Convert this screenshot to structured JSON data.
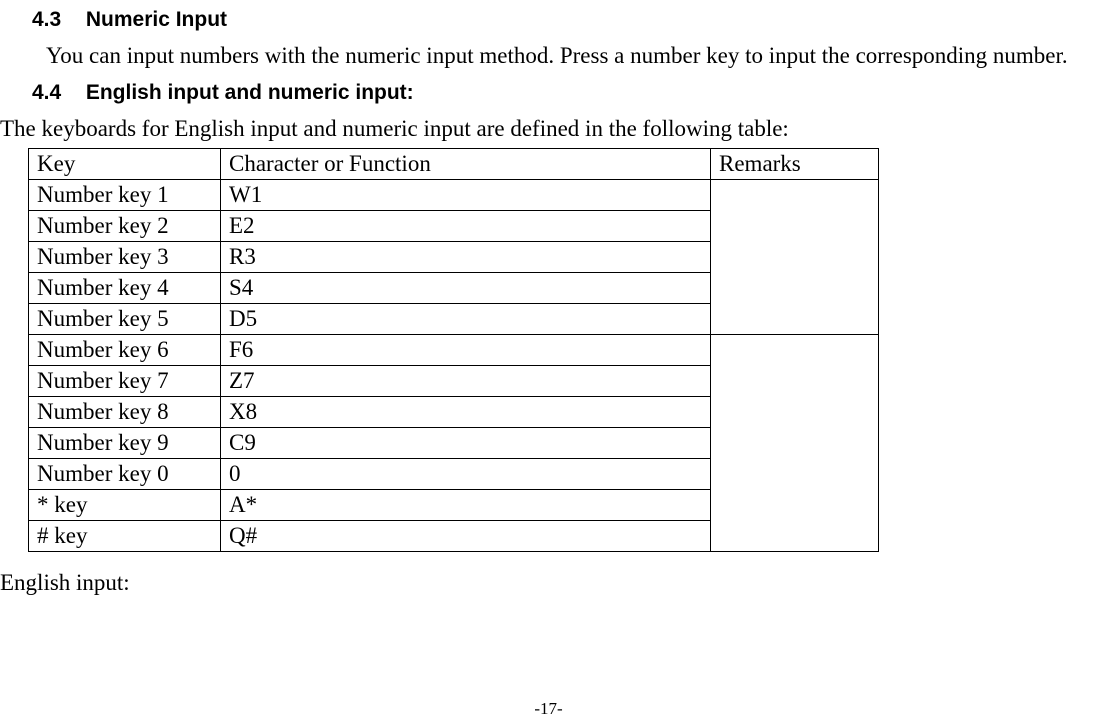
{
  "sections": [
    {
      "number": "4.3",
      "title": "Numeric Input",
      "body": "You can input numbers with the numeric input method. Press a number key to input the corresponding number."
    },
    {
      "number": "4.4",
      "title": "English input and numeric input:",
      "intro": "The keyboards for English input and numeric input are defined in the following table:"
    }
  ],
  "table": {
    "headers": {
      "key": "Key",
      "char": "Character or Function",
      "remarks": "Remarks"
    },
    "rows": [
      {
        "key": "Number key 1",
        "char": "W1"
      },
      {
        "key": "Number key 2",
        "char": "E2"
      },
      {
        "key": "Number key 3",
        "char": "R3"
      },
      {
        "key": "Number key 4",
        "char": "S4"
      },
      {
        "key": "Number key 5",
        "char": "D5"
      },
      {
        "key": "Number key 6",
        "char": "F6"
      },
      {
        "key": "Number key 7",
        "char": "Z7"
      },
      {
        "key": "Number key 8",
        "char": "X8"
      },
      {
        "key": "Number key 9",
        "char": "C9"
      },
      {
        "key": "Number key 0",
        "char": "0"
      },
      {
        "key": "* key",
        "char": "A*"
      },
      {
        "key": "# key",
        "char": "Q#"
      }
    ],
    "remarks_groups": [
      {
        "start": 0,
        "span": 5,
        "text": ""
      },
      {
        "start": 5,
        "span": 7,
        "text": ""
      }
    ]
  },
  "trailing": "English input:",
  "page_footer": "-17-"
}
